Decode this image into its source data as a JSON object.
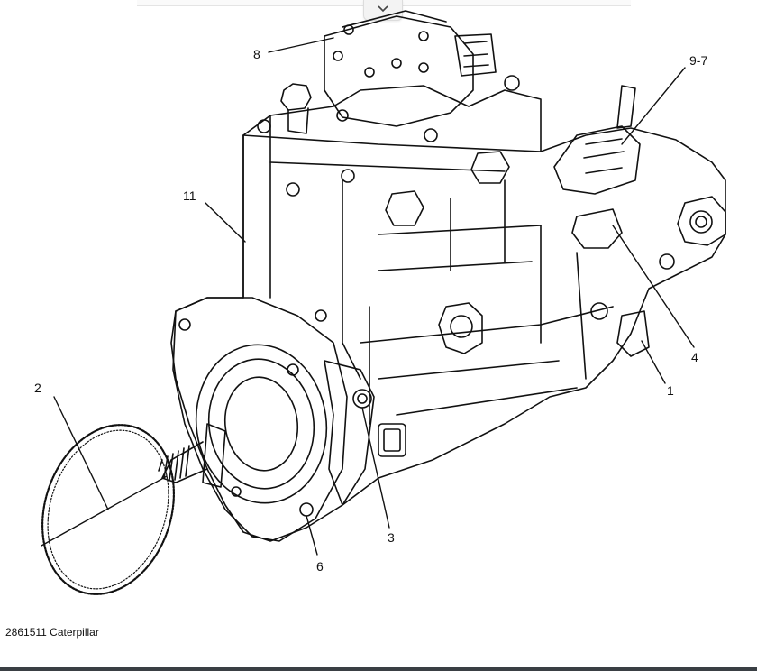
{
  "caption": "2861511 Caterpillar",
  "callouts": {
    "c1": "1",
    "c2": "2",
    "c3": "3",
    "c4": "4",
    "c6": "6",
    "c8": "8",
    "c97": "9-7",
    "c11": "11"
  },
  "icons": {
    "collapse": "chevron-down-icon"
  },
  "colors": {
    "line": "#111111",
    "background": "#ffffff"
  }
}
